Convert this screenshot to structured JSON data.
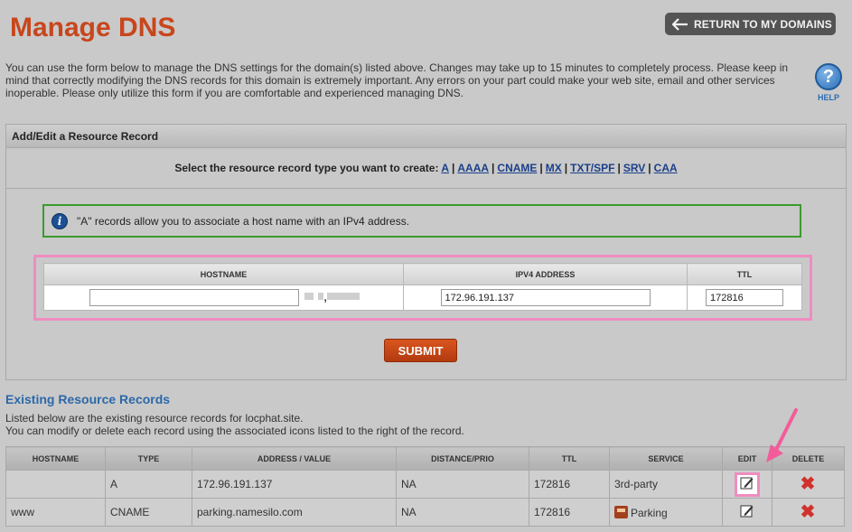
{
  "header": {
    "title": "Manage DNS",
    "return_label": "RETURN TO MY DOMAINS"
  },
  "intro": "You can use the form below to manage the DNS settings for the domain(s) listed above. Changes may take up to 15 minutes to completely process. Please keep in mind that correctly modifying the DNS records for this domain is extremely important. Any errors on your part could make your web site, email and other services inoperable. Please only utilize this form if you are comfortable and experienced managing DNS.",
  "help": {
    "label": "HELP",
    "icon": "question-icon"
  },
  "add_panel": {
    "title": "Add/Edit a Resource Record",
    "type_prompt": "Select the resource record type you want to create:",
    "types": [
      "A",
      "AAAA",
      "CNAME",
      "MX",
      "TXT/SPF",
      "SRV",
      "CAA"
    ],
    "info": "\"A\" records allow you to associate a host name with an IPv4 address.",
    "form": {
      "col_hostname": "HOSTNAME",
      "col_ipv4": "IPV4 ADDRESS",
      "col_ttl": "TTL",
      "hostname_value": "",
      "ipv4_value": "172.96.191.137",
      "ttl_value": "172816"
    },
    "submit_label": "SUBMIT"
  },
  "existing": {
    "title": "Existing Resource Records",
    "line1": "Listed below are the existing resource records for locphat.site.",
    "line2": "You can modify or delete each record using the associated icons listed to the right of the record.",
    "columns": [
      "HOSTNAME",
      "TYPE",
      "ADDRESS / VALUE",
      "DISTANCE/PRIO",
      "TTL",
      "SERVICE",
      "EDIT",
      "DELETE"
    ],
    "rows": [
      {
        "hostname": "",
        "type": "A",
        "value": "172.96.191.137",
        "prio": "NA",
        "ttl": "172816",
        "service": "3rd-party"
      },
      {
        "hostname": "www",
        "type": "CNAME",
        "value": "parking.namesilo.com",
        "prio": "NA",
        "ttl": "172816",
        "service": "Parking"
      }
    ]
  },
  "colors": {
    "title": "#c8461c",
    "link": "#1a3f8a",
    "highlight": "#ef8cc0",
    "info_border": "#3a9a2c"
  }
}
